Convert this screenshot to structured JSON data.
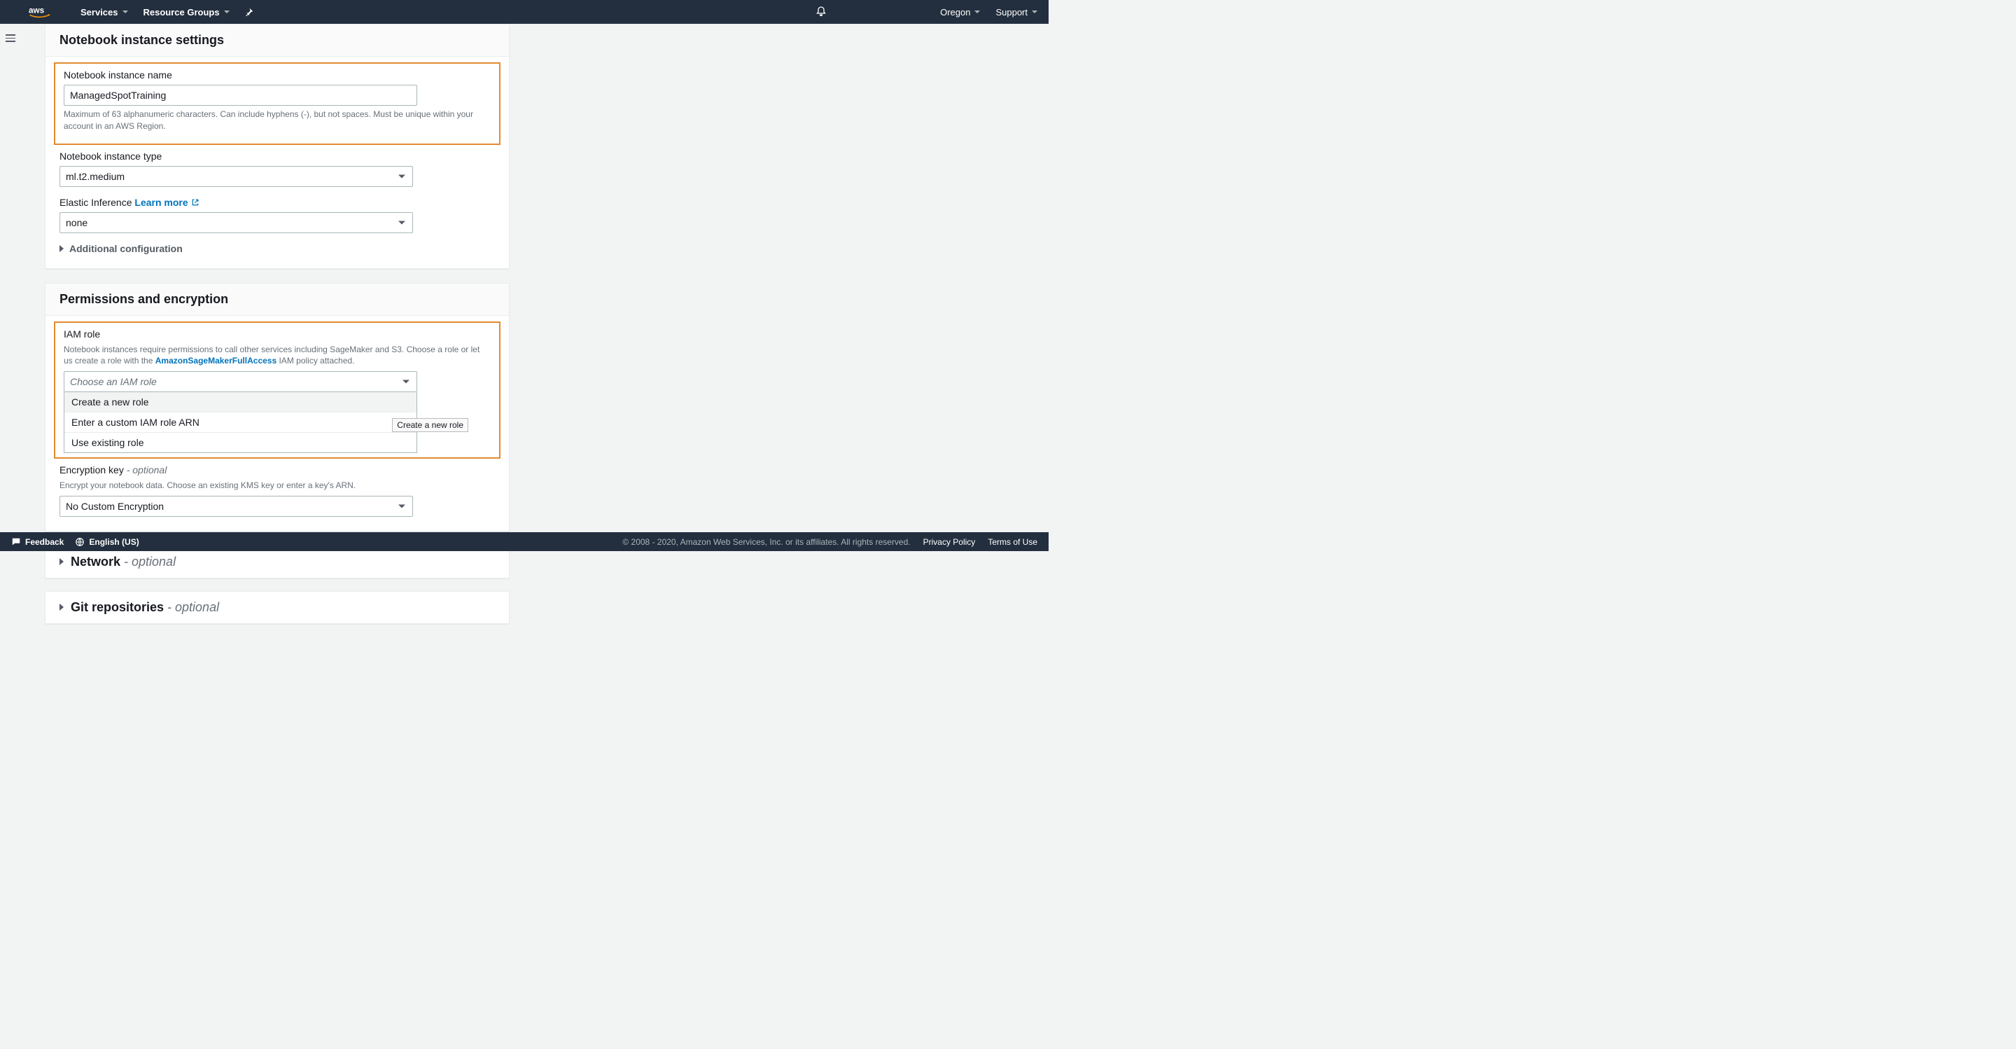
{
  "topnav": {
    "services": "Services",
    "resource_groups": "Resource Groups",
    "region": "Oregon",
    "support": "Support"
  },
  "settings": {
    "title": "Notebook instance settings",
    "name_label": "Notebook instance name",
    "name_value": "ManagedSpotTraining",
    "name_hint": "Maximum of 63 alphanumeric characters. Can include hyphens (-), but not spaces. Must be unique within your account in an AWS Region.",
    "type_label": "Notebook instance type",
    "type_value": "ml.t2.medium",
    "ei_label": "Elastic Inference",
    "ei_learn_more": "Learn more",
    "ei_value": "none",
    "additional_config": "Additional configuration"
  },
  "permissions": {
    "title": "Permissions and encryption",
    "iam_label": "IAM role",
    "iam_hint_pre": "Notebook instances require permissions to call other services including SageMaker and S3. Choose a role or let us create a role with the ",
    "iam_hint_link": "AmazonSageMakerFullAccess",
    "iam_hint_post": " IAM policy attached.",
    "iam_placeholder": "Choose an IAM role",
    "iam_options": {
      "opt1": "Create a new role",
      "opt2": "Enter a custom IAM role ARN",
      "opt3": "Use existing role"
    },
    "iam_tooltip": "Create a new role",
    "enc_label": "Encryption key",
    "enc_optional": " - optional",
    "enc_hint": "Encrypt your notebook data. Choose an existing KMS key or enter a key's ARN.",
    "enc_value": "No Custom Encryption"
  },
  "collapsed": {
    "network": "Network",
    "network_optional": " - optional",
    "git": "Git repositories",
    "git_optional": " - optional"
  },
  "footer": {
    "feedback": "Feedback",
    "language": "English (US)",
    "copy": "© 2008 - 2020, Amazon Web Services, Inc. or its affiliates. All rights reserved.",
    "privacy": "Privacy Policy",
    "terms": "Terms of Use"
  }
}
